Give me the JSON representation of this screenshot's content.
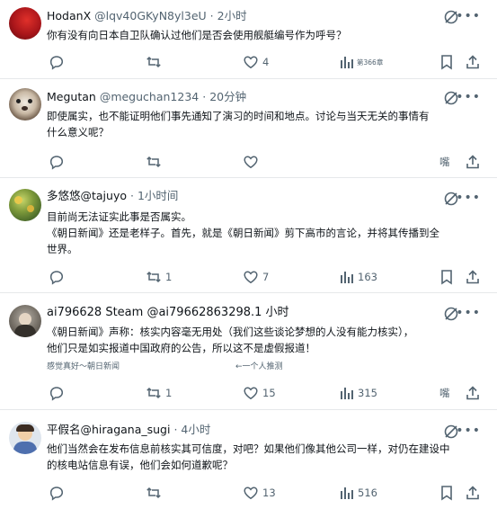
{
  "posts": [
    {
      "name": "HodanX",
      "handle": "@lqv40GKyN8yl3eU",
      "time": "2小时",
      "body": [
        "你有没有向日本自卫队确认过他们是否会使用舰艇编号作为呼号？"
      ],
      "reply_count": "",
      "repost_count": "",
      "like_count": "4",
      "view_count": "第366章",
      "bookmark_label": ""
    },
    {
      "name": "Megutan",
      "handle": "@meguchan1234",
      "time": "20分钟",
      "body": [
        "即使属实，也不能证明他们事先通知了演习的时间和地点。讨论与当天无关的事情有",
        "什么意义呢？"
      ],
      "reply_count": "",
      "repost_count": "",
      "like_count": "",
      "view_count": "",
      "bookmark_label": "嘴"
    },
    {
      "name": "多悠悠@tajuyo",
      "handle": "",
      "time": "1小时间",
      "body": [
        "目前尚无法证实此事是否属实。",
        "《朝日新闻》还是老样子。首先，就是《朝日新闻》剪下高市的言论，并将其传播到全",
        "世界。"
      ],
      "reply_count": "",
      "repost_count": "1",
      "like_count": "7",
      "view_count": "163",
      "bookmark_label": ""
    },
    {
      "name": "ai796628 Steam @ai79662863298.1 小时",
      "handle": "",
      "time": "",
      "body": [
        "《朝日新闻》声称：核实内容毫无用处（我们这些谈论梦想的人没有能力核实），",
        "他们只是如实报道中国政府的公告，所以这不是虚假报道！"
      ],
      "note_left": "感觉真好～朝日新闻",
      "note_right": "←一个人推测",
      "reply_count": "",
      "repost_count": "1",
      "like_count": "15",
      "view_count": "315",
      "bookmark_label": "嘴"
    },
    {
      "name": "平假名@hiragana_sugi",
      "handle": "",
      "time": "4小时",
      "body": [
        "他们当然会在发布信息前核实其可信度，对吧？如果他们像其他公司一样，对仍在建设中",
        "的核电站信息有误，他们会如何道歉呢？"
      ],
      "reply_count": "",
      "repost_count": "",
      "like_count": "13",
      "view_count": "516",
      "bookmark_label": ""
    }
  ],
  "colors": {
    "text": "#0f1419",
    "muted": "#536471",
    "divider": "#e6e8ea"
  },
  "icons": [
    "reply-icon",
    "repost-icon",
    "like-icon",
    "views-icon",
    "bookmark-icon",
    "share-icon",
    "grok-icon",
    "more-icon"
  ]
}
